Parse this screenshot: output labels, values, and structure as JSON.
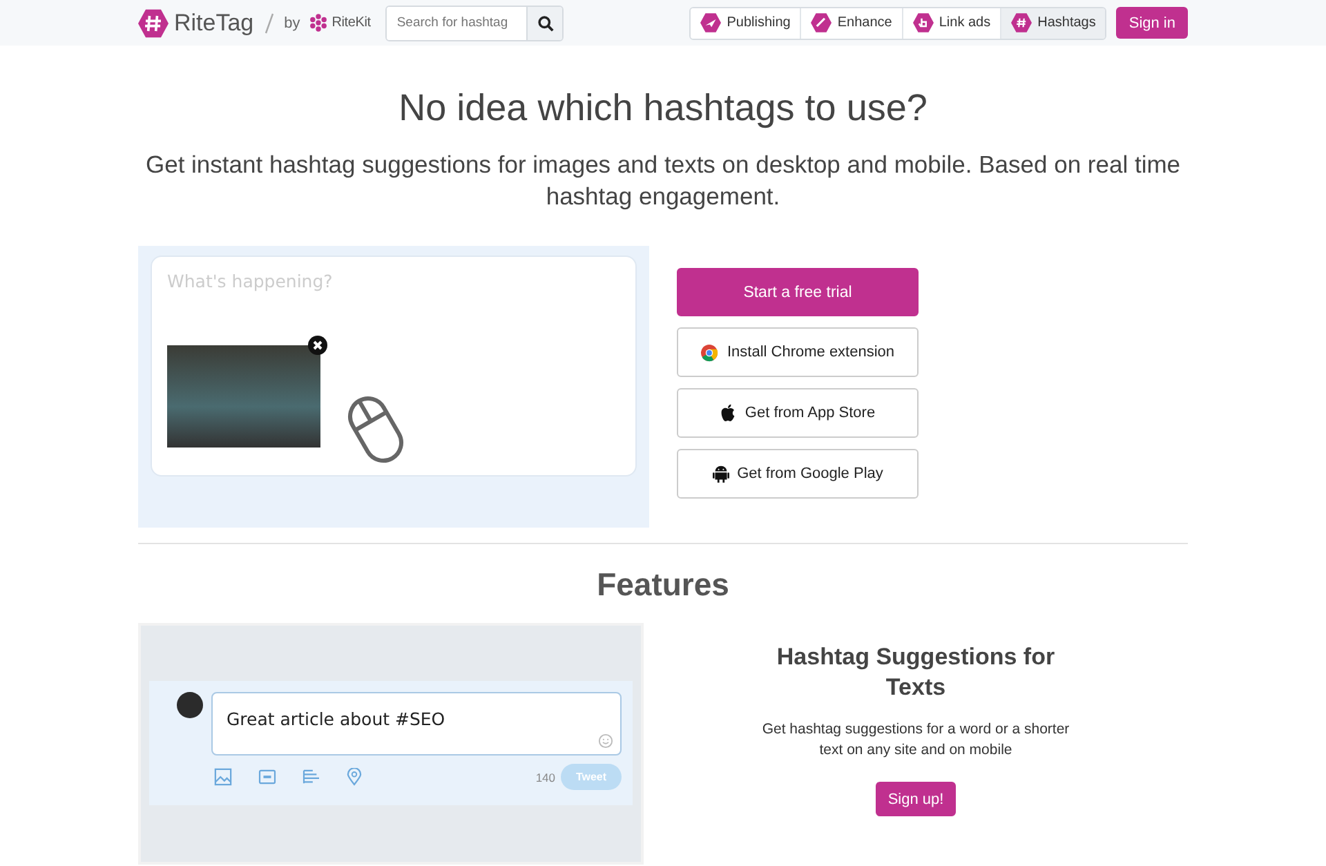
{
  "header": {
    "logo": "RiteTag",
    "by": "by",
    "parent_brand": "RiteKit",
    "search": {
      "placeholder": "Search for hashtag"
    },
    "nav": [
      {
        "label": "Publishing",
        "kind": "publishing",
        "selected": false
      },
      {
        "label": "Enhance",
        "kind": "enhance",
        "selected": false
      },
      {
        "label": "Link ads",
        "kind": "linkads",
        "selected": false
      },
      {
        "label": "Hashtags",
        "kind": "hashtags",
        "selected": true
      }
    ],
    "sign_in": "Sign in"
  },
  "hero": {
    "title": "No idea which hashtags to use?",
    "subtitle": "Get instant hashtag suggestions for images and texts on desktop and mobile. Based on real time hashtag engagement."
  },
  "composer": {
    "placeholder": "What's happening?"
  },
  "actions": [
    {
      "label": "Start a free trial",
      "kind": "primary"
    },
    {
      "label": "Install Chrome extension",
      "kind": "chrome"
    },
    {
      "label": "Get from App Store",
      "kind": "apple"
    },
    {
      "label": "Get from Google Play",
      "kind": "android"
    }
  ],
  "features": {
    "heading": "Features",
    "preview": {
      "text": "Great article about #SEO",
      "counter": "140",
      "button": "Tweet"
    },
    "title": "Hashtag Suggestions for Texts",
    "description": "Get hashtag suggestions for a word or a shorter text on any site and on mobile",
    "button": "Sign up!"
  }
}
